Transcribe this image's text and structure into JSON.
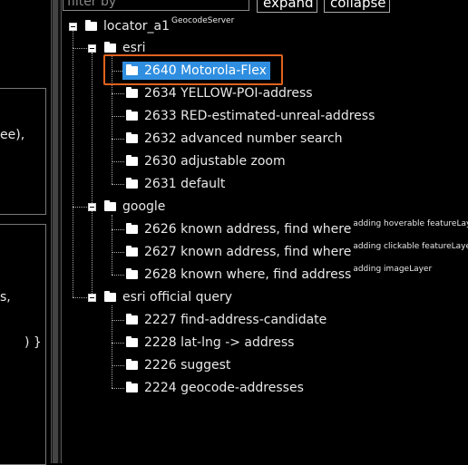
{
  "toolbar": {
    "filter_placeholder": "filter by",
    "expand_label": "expand",
    "collapse_label": "collapse"
  },
  "left_panel": {
    "fragment_1": "ee),",
    "fragment_2": "s,",
    "fragment_3": ") }"
  },
  "tree": {
    "root": {
      "label": "locator_a1",
      "tag": "GeocodeServer"
    },
    "groups": [
      {
        "label": "esri",
        "items": [
          {
            "label": "2640 Motorola-Flex",
            "selected": true
          },
          {
            "label": "2634 YELLOW-POI-address"
          },
          {
            "label": "2633 RED-estimated-unreal-address"
          },
          {
            "label": "2632 advanced number search"
          },
          {
            "label": "2630 adjustable zoom"
          },
          {
            "label": "2631 default"
          }
        ]
      },
      {
        "label": "google",
        "items": [
          {
            "label": "2626 known address, find where",
            "tag": "adding hoverable featureLayer"
          },
          {
            "label": "2627 known address, find where",
            "tag": "adding clickable featureLayer"
          },
          {
            "label": "2628 known where, find address",
            "tag": "adding imageLayer"
          }
        ]
      },
      {
        "label": "esri official query",
        "items": [
          {
            "label": "2227 find-address-candidate"
          },
          {
            "label": "2228 lat-lng -> address"
          },
          {
            "label": "2226 suggest"
          },
          {
            "label": "2224 geocode-addresses"
          }
        ]
      }
    ]
  },
  "colors": {
    "selected_bg": "#2f8ee0",
    "highlight_border": "#e0621d",
    "background": "#000000"
  }
}
